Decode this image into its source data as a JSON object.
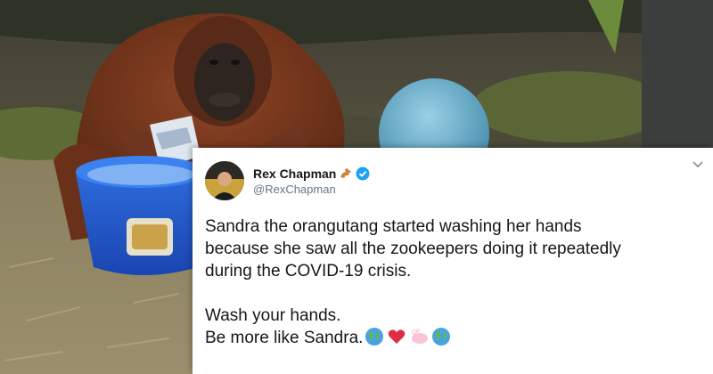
{
  "tweet": {
    "display_name": "Rex Chapman",
    "handle": "@RexChapman",
    "verified_badge_color": "#1da1f2",
    "name_emoji": "horse-racing-emoji",
    "menu_icon": "chevron-down-icon",
    "body_lines": [
      "Sandra the orangutang started washing her hands",
      "because she saw all the zookeepers doing it repeatedly",
      "during the COVID-19 crisis."
    ],
    "closing_lines": [
      "Wash your hands.",
      "Be more like Sandra."
    ],
    "trailing_emojis": [
      "globe-icon",
      "red-heart-icon",
      "soap-icon",
      "globe-icon"
    ]
  },
  "photo": {
    "subject": "orangutan-with-blue-tub-icon"
  }
}
